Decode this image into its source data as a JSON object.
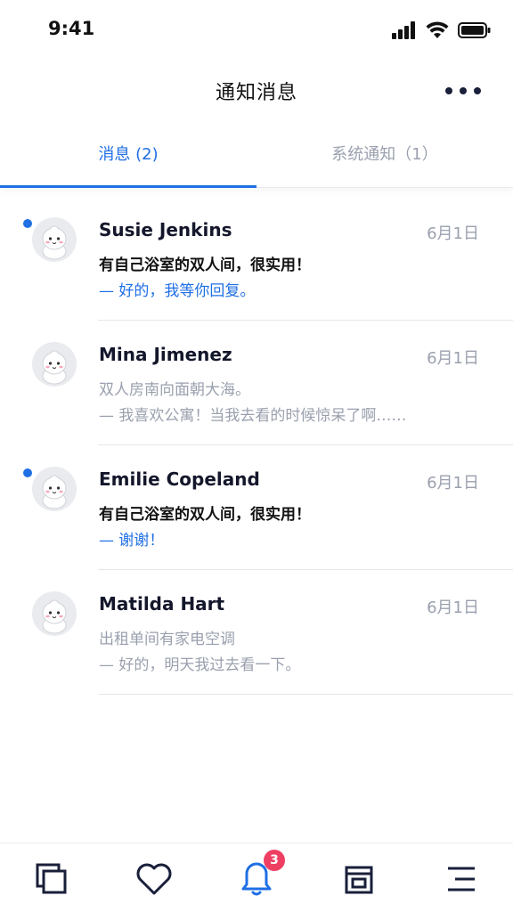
{
  "status_bar": {
    "time": "9:41"
  },
  "header": {
    "title": "通知消息"
  },
  "tabs": [
    {
      "label": "消息 (2)",
      "active": true
    },
    {
      "label": "系统通知（1）",
      "active": false
    }
  ],
  "messages": [
    {
      "name": "Susie Jenkins",
      "date": "6月1日",
      "subject": "有自己浴室的双人间，很实用！",
      "reply": "— 好的，我等你回复。",
      "unread": true
    },
    {
      "name": "Mina Jimenez",
      "date": "6月1日",
      "subject": "双人房南向面朝大海。",
      "reply": "— 我喜欢公寓！当我去看的时候惊呆了啊……",
      "unread": false
    },
    {
      "name": "Emilie Copeland",
      "date": "6月1日",
      "subject": "有自己浴室的双人间，很实用！",
      "reply": "— 谢谢！",
      "unread": true
    },
    {
      "name": "Matilda Hart",
      "date": "6月1日",
      "subject": "出租单间有家电空调",
      "reply": "— 好的，明天我过去看一下。",
      "unread": false
    }
  ],
  "bottom_nav": {
    "items": [
      "copy-icon",
      "heart-icon",
      "bell-icon",
      "card-icon",
      "menu-icon"
    ],
    "badge_count": "3"
  },
  "colors": {
    "accent": "#1f6fe5",
    "badge": "#ee3f63",
    "muted": "#9aa0ae",
    "dark": "#14172b"
  }
}
